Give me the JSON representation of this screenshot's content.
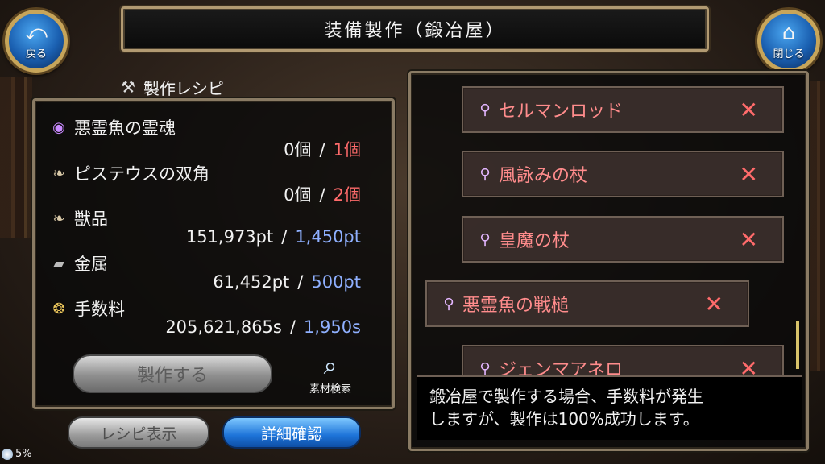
{
  "header": {
    "title": "装備製作（鍛冶屋）",
    "back_label": "戻る",
    "close_label": "閉じる"
  },
  "recipe": {
    "title": "製作レシピ",
    "materials": [
      {
        "name": "悪霊魚の霊魂",
        "icon": "orb-icon",
        "have": "0個",
        "need": "1個",
        "need_color": "red"
      },
      {
        "name": "ピステウスの双角",
        "icon": "horn-icon",
        "have": "0個",
        "need": "2個",
        "need_color": "red"
      },
      {
        "name": "獣品",
        "icon": "horn-icon",
        "have": "151,973pt",
        "need": "1,450pt",
        "need_color": "blue"
      },
      {
        "name": "金属",
        "icon": "metal-icon",
        "have": "61,452pt",
        "need": "500pt",
        "need_color": "blue"
      },
      {
        "name": "手数料",
        "icon": "coin-icon",
        "have": "205,621,865s",
        "need": "1,950s",
        "need_color": "blue"
      }
    ],
    "craft_button": "製作する",
    "search_label": "素材検索",
    "recipe_display": "レシピ表示",
    "detail_confirm": "詳細確認"
  },
  "list": {
    "items": [
      {
        "name": "セルマンロッド",
        "selected": false
      },
      {
        "name": "風詠みの杖",
        "selected": false
      },
      {
        "name": "皇魔の杖",
        "selected": false
      },
      {
        "name": "悪霊魚の戦槌",
        "selected": true
      },
      {
        "name": "ジェンマアネロ",
        "selected": false
      }
    ],
    "x_mark": "✕"
  },
  "description": {
    "line1": "鍛冶屋で製作する場合、手数料が発生",
    "line2": "しますが、製作は100%成功します。"
  },
  "status": {
    "text": "5%"
  },
  "colors": {
    "need_red": "#ff6b6b",
    "need_blue": "#8fb0ff",
    "item_text": "#ff8c8c",
    "frame": "#8a7b64"
  }
}
